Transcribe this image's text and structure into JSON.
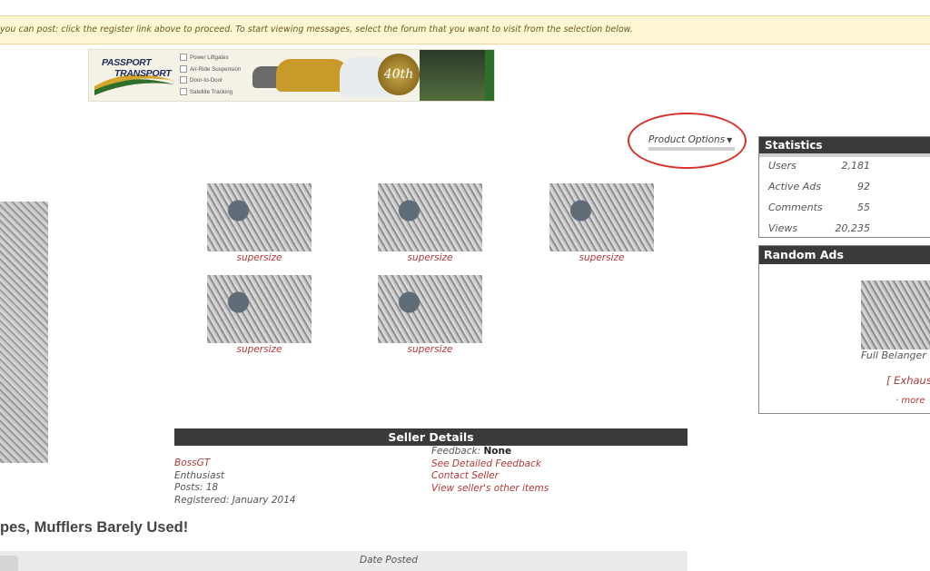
{
  "notice": {
    "text": "you can post: click the register link above to proceed. To start viewing messages, select the forum that you want to visit from the selection below."
  },
  "banner": {
    "logo_line1": "PASSPORT",
    "logo_line2": "TRANSPORT",
    "features": [
      "Power Liftgates",
      "Air-Ride Suspension",
      "Door-to-Door",
      "Satellite Tracking"
    ],
    "seal_text": "40th"
  },
  "product_options": {
    "label": "Product Options",
    "icon": "caret-down-icon"
  },
  "thumbnails": [
    {
      "caption": "supersize"
    },
    {
      "caption": "supersize"
    },
    {
      "caption": "supersize"
    },
    {
      "caption": "supersize"
    },
    {
      "caption": "supersize"
    }
  ],
  "statistics": {
    "title": "Statistics",
    "rows": [
      {
        "label": "Users",
        "value": "2,181"
      },
      {
        "label": "Active Ads",
        "value": "92"
      },
      {
        "label": "Comments",
        "value": "55"
      },
      {
        "label": "Views",
        "value": "20,235"
      }
    ]
  },
  "random_ads": {
    "title": "Random Ads",
    "item_title": "Full Belanger",
    "category": "[ Exhaus",
    "more": "· more"
  },
  "seller": {
    "title": "Seller Details",
    "username": "BossGT",
    "rank": "Enthusiast",
    "posts": "Posts: 18",
    "registered": "Registered: January 2014",
    "feedback_label": "Feedback:",
    "feedback_value": "None",
    "links": [
      "See Detailed Feedback",
      "Contact Seller",
      "View seller's other items"
    ]
  },
  "product_title": "pes, Mufflers Barely Used!",
  "table": {
    "date_posted": "Date Posted"
  },
  "colors": {
    "accent_link": "#b0393a",
    "header_dark": "#3a3a3a",
    "notice_bg": "#fdf6d3",
    "annotation": "#d9312a"
  }
}
